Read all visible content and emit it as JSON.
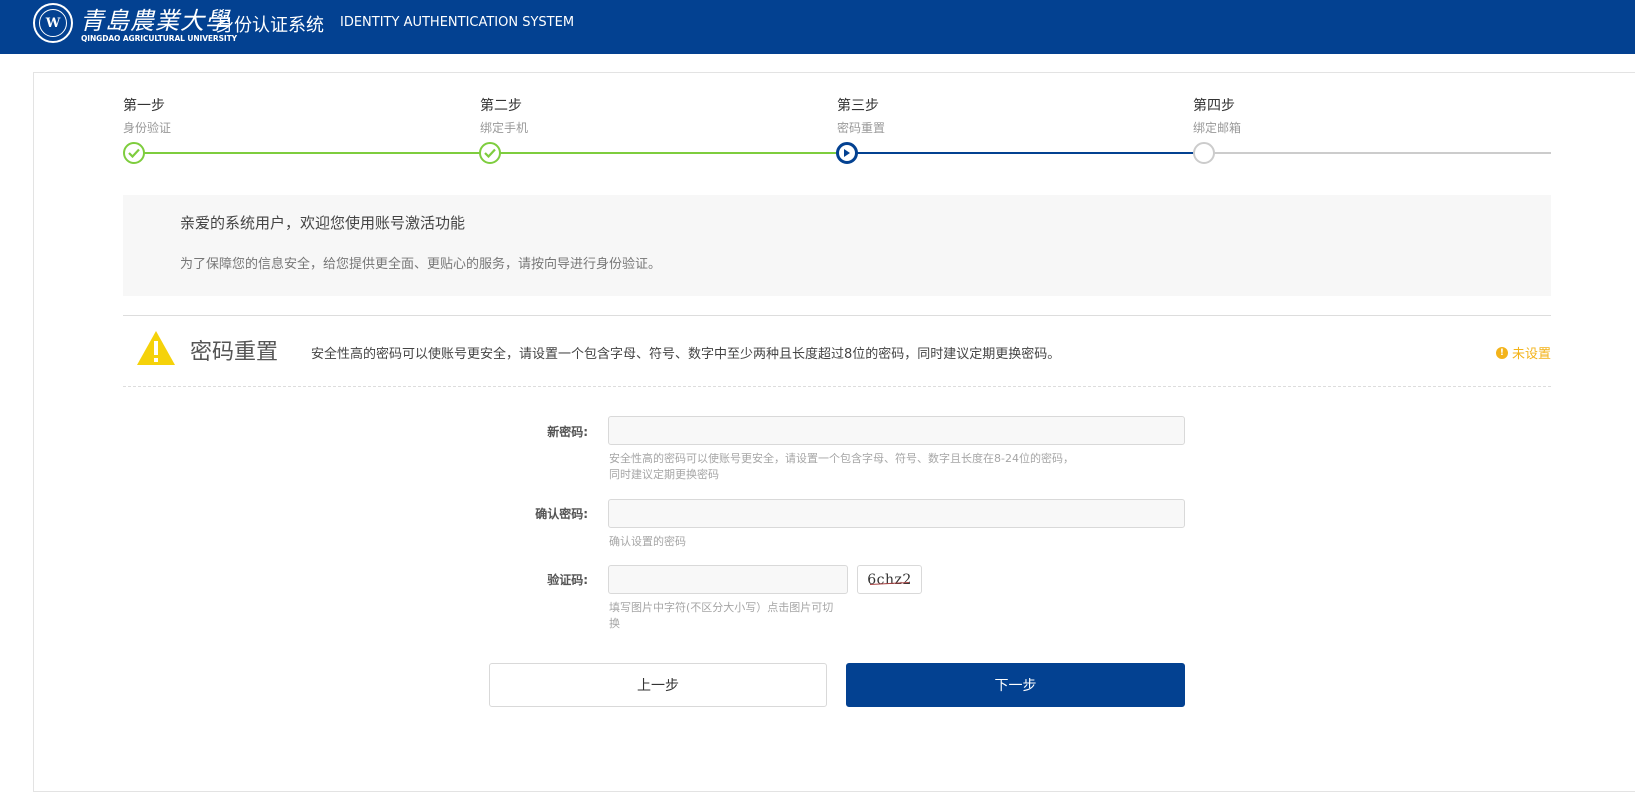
{
  "header": {
    "university_cn": "青島農業大學",
    "university_en": "QINGDAO AGRICULTURAL UNIVERSITY",
    "seal_text": "W",
    "system_cn": "身份认证系统",
    "system_en": "IDENTITY AUTHENTICATION SYSTEM",
    "bg_color": "#034191"
  },
  "steps": [
    {
      "title": "第一步",
      "subtitle": "身份验证",
      "state": "done"
    },
    {
      "title": "第二步",
      "subtitle": "绑定手机",
      "state": "done"
    },
    {
      "title": "第三步",
      "subtitle": "密码重置",
      "state": "current"
    },
    {
      "title": "第四步",
      "subtitle": "绑定邮箱",
      "state": "todo"
    }
  ],
  "welcome": {
    "title": "亲爱的系统用户，欢迎您使用账号激活功能",
    "description": "为了保障您的信息安全，给您提供更全面、更贴心的服务，请按向导进行身份验证。"
  },
  "section": {
    "title": "密码重置",
    "description": "安全性高的密码可以使账号更安全，请设置一个包含字母、符号、数字中至少两种且长度超过8位的密码，同时建议定期更换密码。",
    "status": "未设置",
    "status_icon": "exclamation-icon",
    "warning_icon": "warning-triangle-icon",
    "status_color": "#f3b31a"
  },
  "form": {
    "new_password": {
      "label": "新密码:",
      "value": "",
      "hint_line1": "安全性高的密码可以使账号更安全，请设置一个包含字母、符号、数字且长度在8-24位的密码，",
      "hint_line2": "同时建议定期更换密码"
    },
    "confirm_password": {
      "label": "确认密码:",
      "value": "",
      "hint": "确认设置的密码"
    },
    "captcha": {
      "label": "验证码:",
      "value": "",
      "image_text": "6chz2",
      "hint_line1": "填写图片中字符(不区分大小写）点击图片可切",
      "hint_line2": "换"
    }
  },
  "buttons": {
    "prev": "上一步",
    "next": "下一步",
    "accent_color": "#034191"
  },
  "colors": {
    "done": "#7ecd3e",
    "current": "#034191",
    "todo": "#cccccc"
  }
}
